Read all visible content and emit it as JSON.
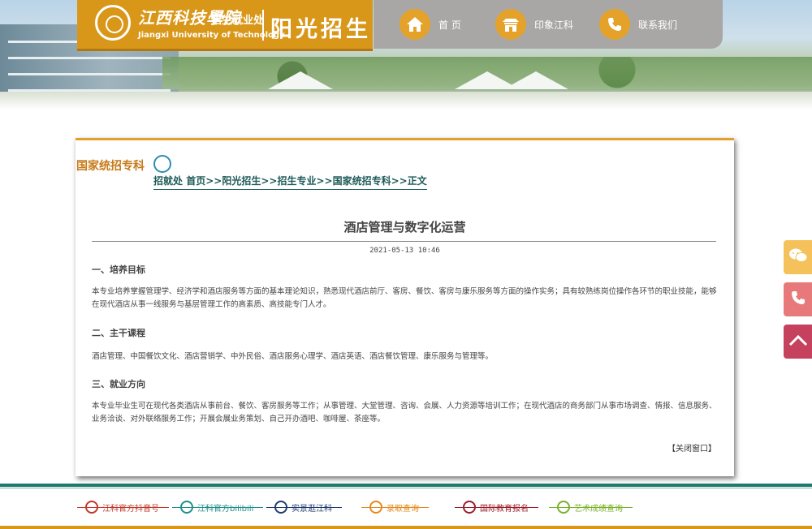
{
  "header": {
    "school_name_cn": "江西科技學院",
    "dept_label": "招生就业处",
    "school_name_en": "Jiangxi University of Technology",
    "site_title": "阳光招生",
    "nav": [
      {
        "label": "首 页",
        "icon": "home-icon"
      },
      {
        "label": "印象江科",
        "icon": "building-icon"
      },
      {
        "label": "联系我们",
        "icon": "phone-icon"
      }
    ]
  },
  "panel": {
    "section_title": "国家统招专科",
    "breadcrumb": [
      "招就处",
      "首页",
      ">>",
      "阳光招生",
      ">>",
      "招生专业",
      ">>",
      "国家统招专科",
      ">>",
      "正文"
    ]
  },
  "article": {
    "title": "酒店管理与数字化运营",
    "date": "2021-05-13 10:46",
    "sections": [
      {
        "heading": "一、培养目标",
        "body": "本专业培养掌握管理学、经济学和酒店服务等方面的基本理论知识，熟悉现代酒店前厅、客房、餐饮、客房与康乐服务等方面的操作实务；具有较熟练岗位操作各环节的职业技能，能够在现代酒店从事一线服务与基层管理工作的高素质、高技能专门人才。"
      },
      {
        "heading": "二、主干课程",
        "body": "酒店管理、中国餐饮文化、酒店营销学、中外民俗、酒店服务心理学、酒店英语、酒店餐饮管理、康乐服务与管理等。"
      },
      {
        "heading": "三、就业方向",
        "body": "本专业毕业生可在现代各类酒店从事前台、餐饮、客房服务等工作；从事管理、大堂管理、咨询、会展、人力资源等培训工作；在现代酒店的商务部门从事市场调查、情报、信息服务、业务洽谈、对外联络服务工作；开展会展业务策划、自己开办酒吧、咖啡屋、茶座等。"
      }
    ],
    "close_label": "【关闭窗口】"
  },
  "side_buttons": [
    {
      "icon": "wechat-icon",
      "color": "#f5c15a"
    },
    {
      "icon": "phone-icon",
      "color": "#e8797a"
    },
    {
      "icon": "back-to-top-icon",
      "color": "#c6415e"
    }
  ],
  "footer": {
    "links": [
      {
        "label": "江科官方抖音号",
        "color": "#c0392b",
        "icon": "douyin-icon"
      },
      {
        "label": "江科官方bilibili",
        "color": "#1f8f8a",
        "icon": "bilibili-icon"
      },
      {
        "label": "实景逛江科",
        "color": "#1e3c6e",
        "icon": "globe-icon"
      },
      {
        "label": "录取查询",
        "color": "#e58a1f",
        "icon": "search-icon"
      },
      {
        "label": "国际教育报名",
        "color": "#9b1d2a",
        "icon": "people-icon"
      },
      {
        "label": "艺术成绩查询",
        "color": "#7bb12a",
        "icon": "monitor-icon"
      }
    ]
  },
  "colors": {
    "accent": "#d9971a",
    "nav_bg": "#a9a7a5",
    "breadcrumb": "#1f5b59",
    "footer_bar": "#1f7a6e"
  }
}
